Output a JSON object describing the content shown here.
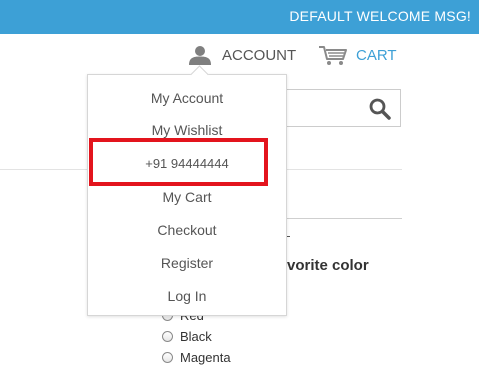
{
  "header": {
    "welcome_msg": "DEFAULT WELCOME MSG!",
    "account_label": "ACCOUNT",
    "cart_label": "CART"
  },
  "account_menu": {
    "items": [
      "My Account",
      "My Wishlist",
      "+91 94444444",
      "My Cart",
      "Checkout",
      "Register",
      "Log In"
    ]
  },
  "poll": {
    "question_fragment": "vorite color",
    "options": [
      "Red",
      "Black",
      "Magenta"
    ]
  },
  "colors": {
    "topbar": "#3da0d6",
    "cart_link": "#3da0d6",
    "highlight": "#e3141d"
  },
  "icons": {
    "account": "user-icon",
    "cart": "cart-icon",
    "search": "search-icon"
  }
}
